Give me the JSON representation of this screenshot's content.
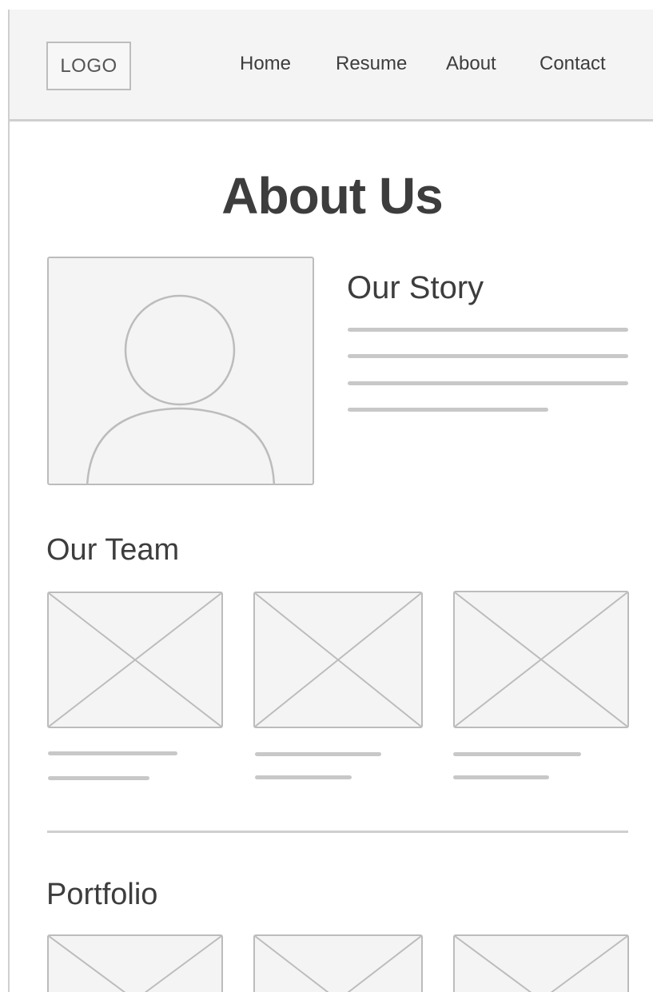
{
  "header": {
    "logo": "LOGO",
    "nav": [
      "Home",
      "Resume",
      "About",
      "Contact"
    ]
  },
  "main": {
    "title": "About Us",
    "story": {
      "heading": "Our Story"
    },
    "team": {
      "heading": "Our Team"
    },
    "portfolio": {
      "heading": "Portfolio"
    }
  },
  "icons": {
    "profile": "user-silhouette-icon",
    "image": "image-placeholder-icon"
  },
  "colors": {
    "header_bg": "#f4f4f4",
    "placeholder": "#c8c8c8",
    "text": "#3e3d3d"
  }
}
